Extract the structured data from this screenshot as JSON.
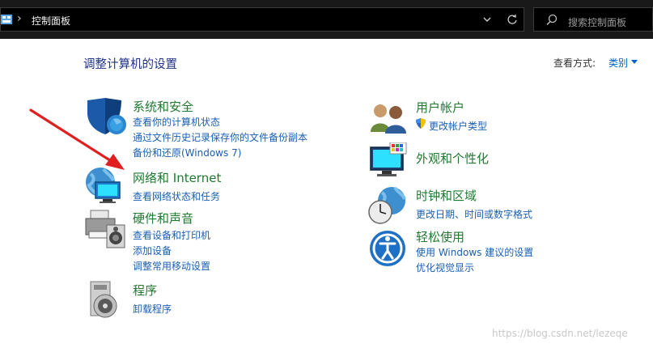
{
  "address_bar": {
    "path": "控制面板"
  },
  "search": {
    "placeholder": "搜索控制面板"
  },
  "heading": "调整计算机的设置",
  "view_by": {
    "label": "查看方式:",
    "value": "类别"
  },
  "left_categories": [
    {
      "title": "系统和安全",
      "links": [
        "查看你的计算机状态",
        "通过文件历史记录保存你的文件备份副本",
        "备份和还原(Windows 7)"
      ]
    },
    {
      "title": "网络和 Internet",
      "links": [
        "查看网络状态和任务"
      ]
    },
    {
      "title": "硬件和声音",
      "links": [
        "查看设备和打印机",
        "添加设备",
        "调整常用移动设置"
      ]
    },
    {
      "title": "程序",
      "links": [
        "卸载程序"
      ]
    }
  ],
  "right_categories": [
    {
      "title": "用户帐户",
      "links": [
        "更改帐户类型"
      ]
    },
    {
      "title": "外观和个性化",
      "links": []
    },
    {
      "title": "时钟和区域",
      "links": [
        "更改日期、时间或数字格式"
      ]
    },
    {
      "title": "轻松使用",
      "links": [
        "使用 Windows 建议的设置",
        "优化视觉显示"
      ]
    }
  ],
  "watermark": "https://blog.csdn.net/lezeqe",
  "colors": {
    "link": "#1a5fb4",
    "category_title": "#1f7a30",
    "heading": "#1e3287",
    "annotation_arrow": "#e02020"
  }
}
